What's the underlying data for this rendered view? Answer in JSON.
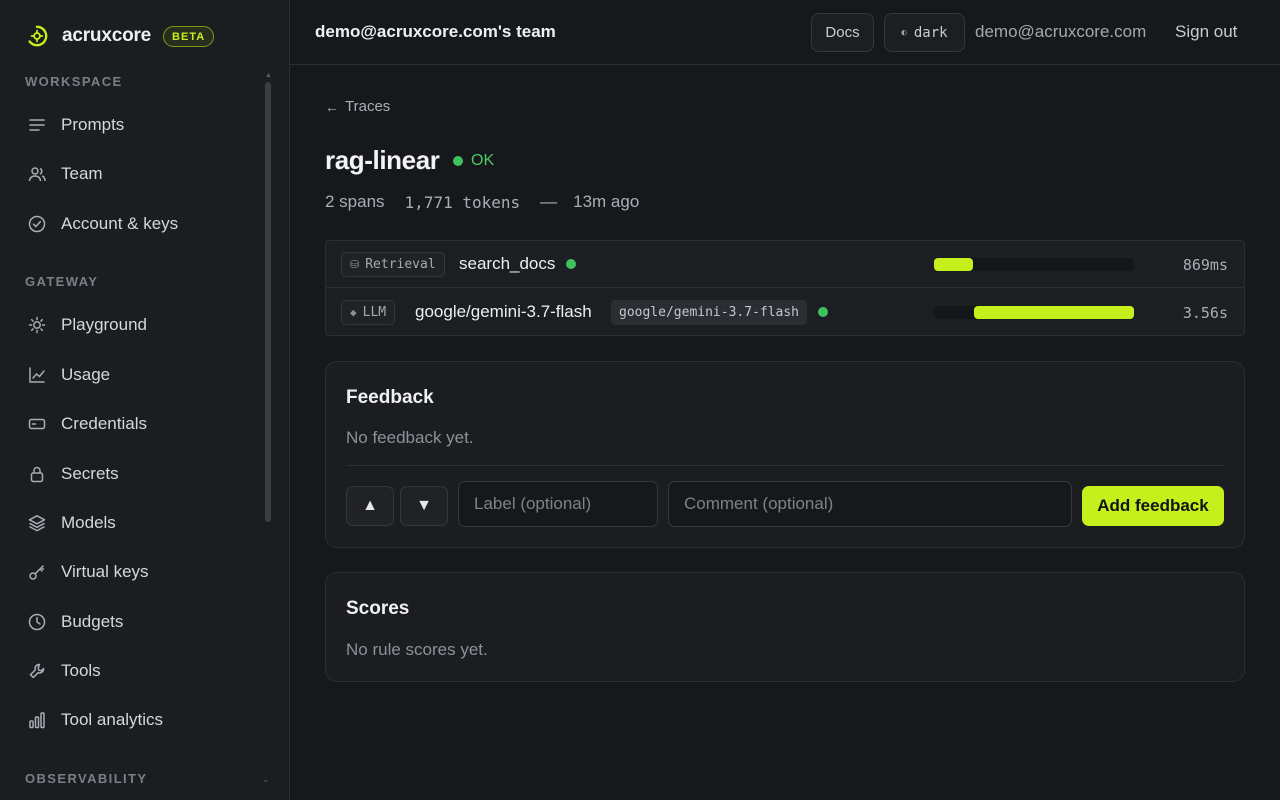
{
  "brand": {
    "name": "acruxcore",
    "badge": "BETA"
  },
  "sidebar": {
    "sections": [
      {
        "title": "WORKSPACE",
        "items": [
          {
            "label": "Prompts",
            "icon": "lines-icon"
          },
          {
            "label": "Team",
            "icon": "users-icon"
          },
          {
            "label": "Account & keys",
            "icon": "check-circle-icon"
          }
        ]
      },
      {
        "title": "GATEWAY",
        "items": [
          {
            "label": "Playground",
            "icon": "sun-icon"
          },
          {
            "label": "Usage",
            "icon": "line-chart-icon"
          },
          {
            "label": "Credentials",
            "icon": "card-icon"
          },
          {
            "label": "Secrets",
            "icon": "lock-icon"
          },
          {
            "label": "Models",
            "icon": "layers-icon"
          },
          {
            "label": "Virtual keys",
            "icon": "key-icon"
          },
          {
            "label": "Budgets",
            "icon": "clock-icon"
          },
          {
            "label": "Tools",
            "icon": "wrench-icon"
          },
          {
            "label": "Tool analytics",
            "icon": "bar-chart-icon"
          }
        ]
      },
      {
        "title": "OBSERVABILITY",
        "items": []
      }
    ]
  },
  "header": {
    "team": "demo@acruxcore.com's team",
    "docs_label": "Docs",
    "theme_label": "dark",
    "email": "demo@acruxcore.com",
    "signout_label": "Sign out"
  },
  "trace": {
    "back_label": "Traces",
    "name": "rag-linear",
    "status": "OK",
    "spans_count": "2 spans",
    "tokens": "1,771 tokens",
    "separator": "—",
    "age": "13m ago",
    "spans": [
      {
        "kind": "Retrieval",
        "name": "search_docs",
        "model": "",
        "status_color": "#3fc25e",
        "start_fraction": 0.0,
        "duration_fraction": 0.195,
        "duration": "869ms"
      },
      {
        "kind": "LLM",
        "name": "google/gemini-3.7-flash",
        "model": "google/gemini-3.7-flash",
        "status_color": "#3fc25e",
        "start_fraction": 0.2,
        "duration_fraction": 0.8,
        "duration": "3.56s"
      }
    ]
  },
  "feedback": {
    "title": "Feedback",
    "empty": "No feedback yet.",
    "label_placeholder": "Label (optional)",
    "comment_placeholder": "Comment (optional)",
    "submit_label": "Add feedback"
  },
  "scores": {
    "title": "Scores",
    "empty": "No rule scores yet."
  },
  "colors": {
    "accent": "#c6f01b",
    "ok": "#3fc25e",
    "background": "#16181c"
  }
}
